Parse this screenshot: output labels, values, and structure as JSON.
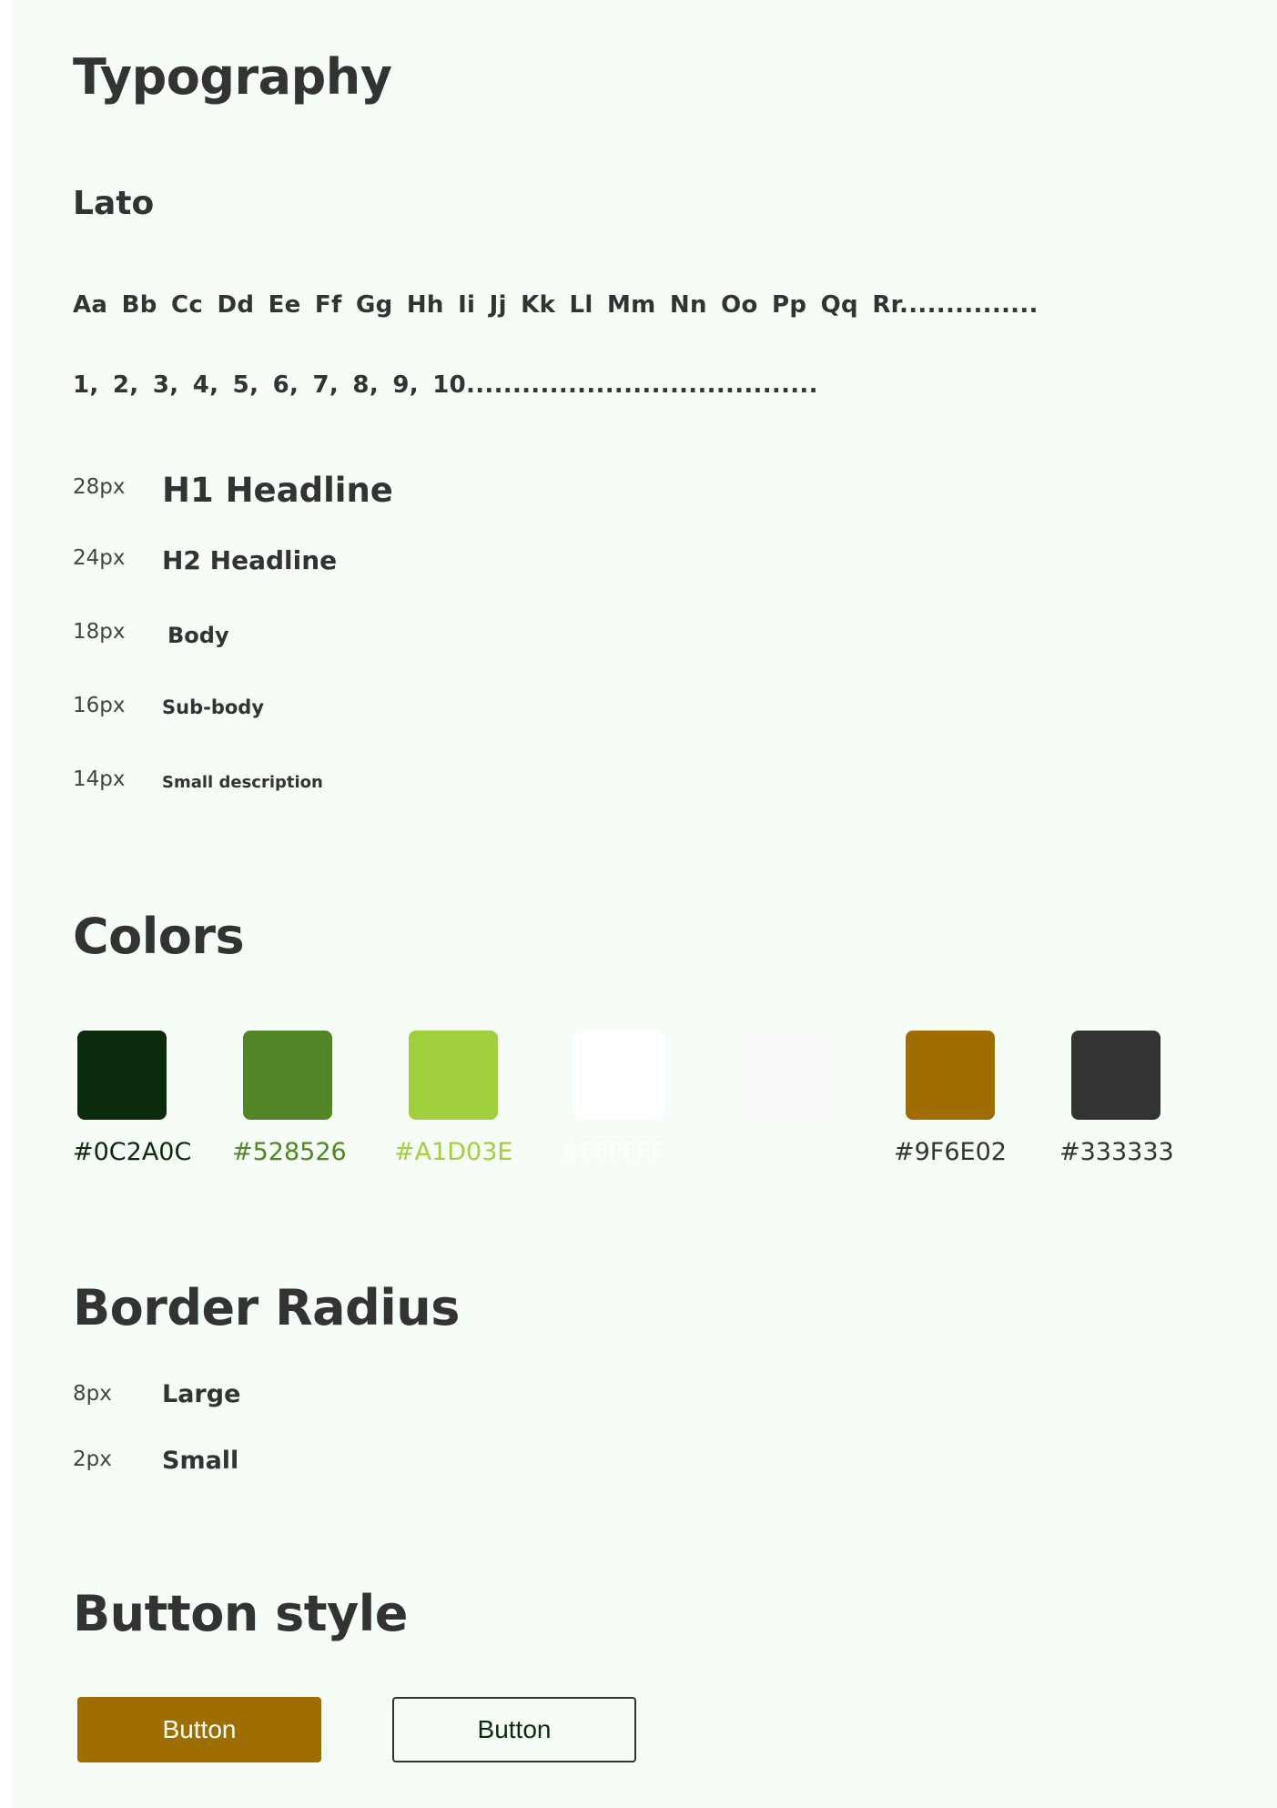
{
  "typography": {
    "title": "Typography",
    "font_name": "Lato",
    "alphabet_sample": "Aa  Bb  Cc  Dd  Ee  Ff  Gg  Hh  Ii  Jj  Kk  Ll  Mm   Nn  Oo  Pp  Qq  Rr...............",
    "number_sample": "1,  2,  3,  4,  5,  6,  7,   8,  9,  10......................................",
    "scale": [
      {
        "size": "28px",
        "label": "H1 Headline"
      },
      {
        "size": "24px",
        "label": "H2 Headline"
      },
      {
        "size": "18px",
        "label": "Body"
      },
      {
        "size": "16px",
        "label": "Sub-body"
      },
      {
        "size": "14px",
        "label": "Small description"
      }
    ]
  },
  "colors": {
    "title": "Colors",
    "swatches": [
      {
        "hex": "#0C2A0C",
        "label_color": "#0C2A0C"
      },
      {
        "hex": "#528526",
        "label_color": "#528526"
      },
      {
        "hex": "#A1D03E",
        "label_color": "#A1D03E"
      },
      {
        "hex": "#FFFFFF",
        "label_color": "#FFFFFF"
      },
      {
        "hex": "#FAFAFA",
        "label_color": "#FAFAFA"
      },
      {
        "hex": "#9F6E02",
        "label_color": "#333333"
      },
      {
        "hex": "#333333",
        "label_color": "#333333"
      }
    ]
  },
  "border_radius": {
    "title": "Border Radius",
    "items": [
      {
        "size": "8px",
        "label": "Large"
      },
      {
        "size": "2px",
        "label": "Small"
      }
    ]
  },
  "button_style": {
    "title": "Button style",
    "primary_label": "Button",
    "secondary_label": "Button",
    "primary_color": "#9F6E02",
    "secondary_border_color": "#333333"
  },
  "theme": {
    "page_background": "#F6FCF6",
    "text_color": "#333333"
  }
}
